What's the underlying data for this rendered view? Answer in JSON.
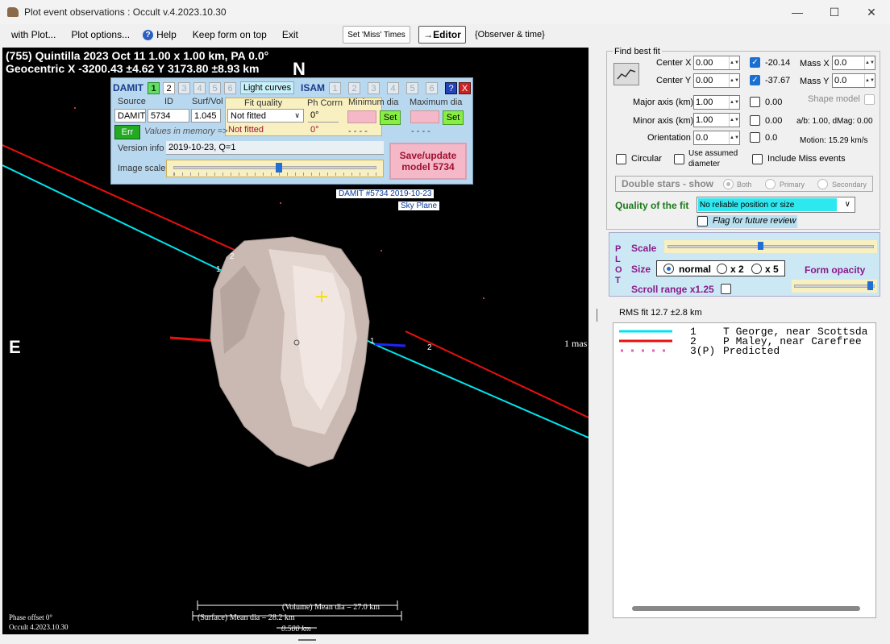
{
  "window": {
    "title": "Plot event observations : Occult v.4.2023.10.30",
    "minimize": "—",
    "maximize": "☐",
    "close": "✕"
  },
  "menu": {
    "with_plot": "with Plot...",
    "plot_options": "Plot options...",
    "help": "Help",
    "keep_on_top": "Keep form on top",
    "exit": "Exit",
    "set_miss_times": "Set 'Miss' Times",
    "editor": "→Editor",
    "observer_time": "{Observer & time}"
  },
  "plot": {
    "header_line1": "(755) Quintilla  2023 Oct 11  1.00 x 1.00 km, PA 0.0°",
    "header_line2": "Geocentric  X  -3200.43 ±4.62  Y 3173.80 ±8.93 km",
    "north": "N",
    "east": "E",
    "mas_label": "1 mas",
    "chord_labels": [
      "1",
      "2",
      "1",
      "2"
    ],
    "sky_label_1": "DAMIT #5734 2019-10-23",
    "sky_label_2": "Sky Plane",
    "volume_dia": "(Volume) Mean dia = 27.0 km",
    "surface_dia": "(Surface) Mean dia = 28.2 km",
    "scale_bar": "0.500 km",
    "phase_offset": "Phase offset 0°",
    "version": "Occult 4.2023.10.30",
    "colors": {
      "chord1": "#00e5ee",
      "chord2": "#e81010",
      "asteroid": "#d8c8c0"
    }
  },
  "damit": {
    "damit_label": "DAMIT",
    "damit_nums": [
      "1",
      "2",
      "3",
      "4",
      "5",
      "6"
    ],
    "light_curves": "Light curves",
    "isam_label": "ISAM",
    "isam_nums": [
      "1",
      "2",
      "3",
      "4",
      "5",
      "6"
    ],
    "help_q": "?",
    "close_x": "X",
    "source_label": "Source",
    "id_label": "ID",
    "surfvol_label": "Surf/Vol",
    "source_value": "DAMIT",
    "id_value": "5734",
    "surfvol_value": "1.045",
    "fit_quality_label": "Fit quality",
    "fit_quality_value": "Not fitted",
    "fit_quality_memory": "Not fitted",
    "ph_corrn_label": "Ph Corrn",
    "ph_corrn_value": "0°",
    "ph_corrn_memory": "0°",
    "min_dia_label": "Minimum dia",
    "max_dia_label": "Maximum dia",
    "set": "Set",
    "dashes": "- - - -",
    "err": "Err",
    "values_in_memory": "Values in memory =>",
    "version_info_label": "Version info",
    "version_info_value": "2019-10-23, Q=1",
    "image_scale_label": "Image scale",
    "save_line1": "Save/update",
    "save_line2": "model 5734"
  },
  "right": {
    "find_best_fit": "Find best fit",
    "center_x_label": "Center X",
    "center_x": "0.00",
    "center_y_label": "Center Y",
    "center_y": "0.00",
    "cx_result": "-20.14",
    "cy_result": "-37.67",
    "mass_x_label": "Mass X",
    "mass_x": "0.0",
    "mass_y_label": "Mass Y",
    "mass_y": "0.0",
    "major_axis_label": "Major axis (km)",
    "major_axis": "1.00",
    "major_result": "0.00",
    "shape_model": "Shape model",
    "minor_axis_label": "Minor axis (km)",
    "minor_axis": "1.00",
    "minor_result": "0.00",
    "ab_dmag": "a/b: 1.00, dMag: 0.00",
    "orientation_label": "Orientation",
    "orientation": "0.0",
    "orientation_result": "0.0",
    "motion": "Motion: 15.29 km/s",
    "circular": "Circular",
    "use_assumed_1": "Use assumed",
    "use_assumed_2": "diameter",
    "include_miss": "Include Miss events",
    "double_stars": "Double stars - show",
    "both": "Both",
    "primary": "Primary",
    "secondary": "Secondary",
    "quality_label": "Quality of the fit",
    "quality_value": "No reliable position or size",
    "flag_review": "Flag for future review",
    "plot_letters": [
      "P",
      "L",
      "O",
      "T"
    ],
    "scale_label": "Scale",
    "size_label": "Size",
    "size_normal": "normal",
    "size_x2": "x 2",
    "size_x5": "x 5",
    "form_opacity": "Form opacity",
    "scroll_range": "Scroll range x1.25",
    "rms_fit": "RMS fit 12.7 ±2.8 km"
  },
  "legend": {
    "rows": [
      {
        "num": "1",
        "name": "T George, near Scottsda",
        "color": "#00e5ee"
      },
      {
        "num": "2",
        "name": "P Maley, near Carefree",
        "color": "#e81010"
      },
      {
        "num": "3(P)",
        "name": "Predicted",
        "color": "#e060c0"
      }
    ]
  }
}
